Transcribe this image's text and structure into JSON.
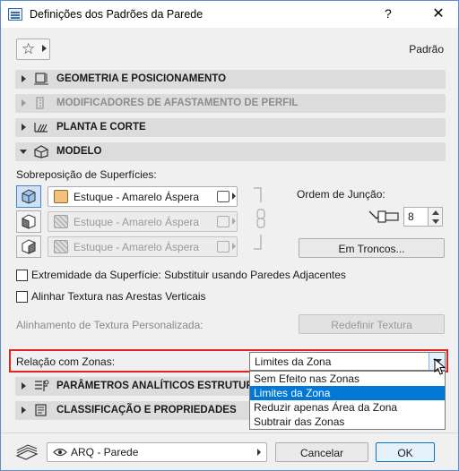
{
  "window": {
    "title": "Definições dos Padrões da Parede",
    "help": "?",
    "close": "✕"
  },
  "header": {
    "favorites_icon": "star-icon",
    "default_label": "Padrão"
  },
  "sections": {
    "geometry": "GEOMETRIA E POSICIONAMENTO",
    "modifiers": "MODIFICADORES DE AFASTAMENTO DE PERFIL",
    "plan": "PLANTA E CORTE",
    "model": "MODELO",
    "analytic": "PARÂMETROS ANALÍTICOS ESTRUTURAIS",
    "classification": "CLASSIFICAÇÃO E PROPRIEDADES"
  },
  "model": {
    "surface_override_label": "Sobreposição de Superfícies:",
    "surfaces": [
      {
        "name": "Estuque - Amarelo Áspera",
        "enabled": true
      },
      {
        "name": "Estuque - Amarelo Áspera",
        "enabled": false
      },
      {
        "name": "Estuque - Amarelo Áspera",
        "enabled": false
      }
    ],
    "junction_order_label": "Ordem de Junção:",
    "junction_order_value": "8",
    "logs_button": "Em Troncos...",
    "edge_checkbox_label": "Extremidade da Superfície: Substituir usando Paredes Adjacentes",
    "edge_checkbox_checked": false,
    "align_checkbox_label": "Alinhar Textura nas Arestas Verticais",
    "align_checkbox_checked": false,
    "custom_texture_label": "Alinhamento de Textura Personalizada:",
    "reset_texture_button": "Redefinir Textura",
    "zone_relation_label": "Relação com Zonas:",
    "zone_relation_value": "Limites da Zona",
    "zone_options": [
      "Sem Efeito nas Zonas",
      "Limites da Zona",
      "Reduzir apenas Área da Zona",
      "Subtrair das Zonas"
    ],
    "zone_selected_index": 1
  },
  "footer": {
    "view_set": "ARQ - Parede",
    "cancel": "Cancelar",
    "ok": "OK"
  },
  "colors": {
    "accent": "#0078d7",
    "highlight_border": "#e02424",
    "section_bg": "#dcdcdc",
    "material_swatch": "#f3c27a"
  }
}
